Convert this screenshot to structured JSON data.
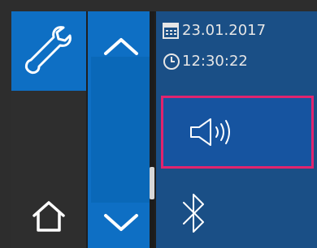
{
  "status": {
    "date": "23.01.2017",
    "time": "12:30:22"
  },
  "icons": {
    "settings": "wrench-icon",
    "home": "home-icon",
    "scroll_up": "chevron-up-icon",
    "scroll_down": "chevron-down-icon",
    "calendar": "calendar-icon",
    "clock": "clock-icon",
    "sound": "speaker-icon",
    "bluetooth": "bluetooth-icon"
  },
  "colors": {
    "accent_blue": "#0e6fc4",
    "panel_blue": "#1a4f86",
    "selection": "#e0246e"
  }
}
